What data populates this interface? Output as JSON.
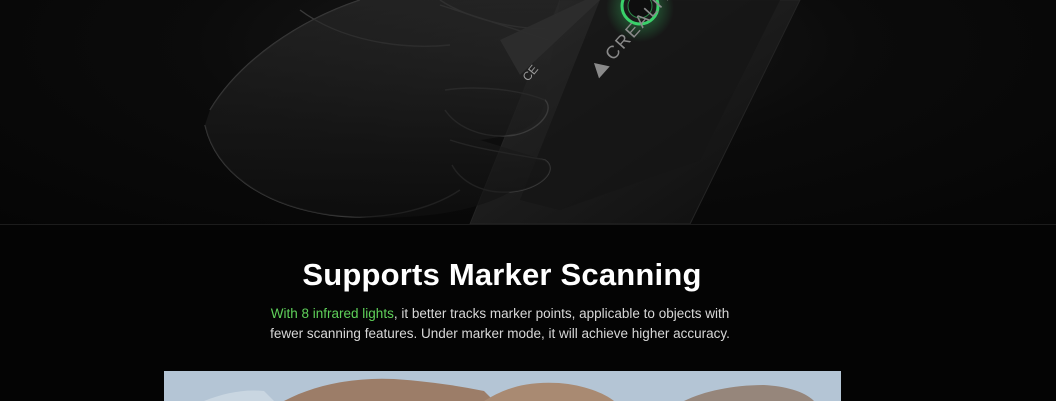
{
  "hero": {
    "device_brand": "CREALITY",
    "device_label_text": "CE"
  },
  "section": {
    "title": "Supports Marker Scanning",
    "description_highlight": "With 8 infrared lights",
    "description_line1_rest": ", it better tracks marker points, applicable to objects with",
    "description_line2": "fewer scanning features. Under marker mode, it will achieve higher accuracy."
  },
  "colors": {
    "background": "#000000",
    "title": "#ffffff",
    "body_text": "#d8d8d8",
    "highlight": "#5fd15a",
    "button_ring": "#3ad16a"
  },
  "icons": [
    "creality-logo-icon",
    "power-button-icon"
  ]
}
